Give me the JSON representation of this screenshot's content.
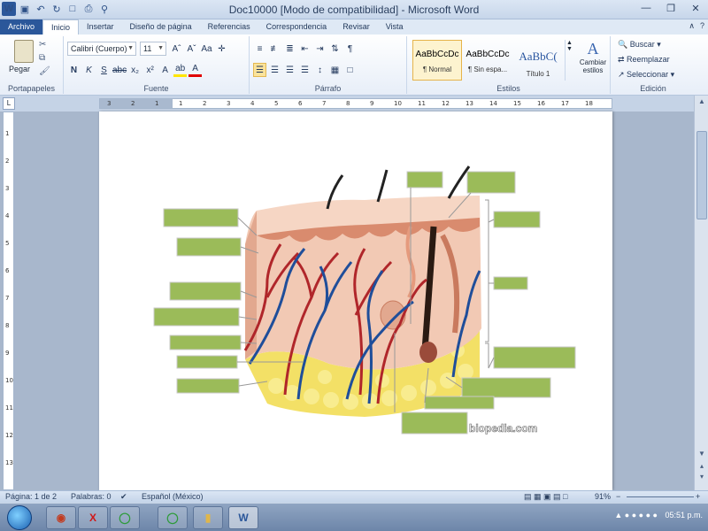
{
  "window": {
    "title": "Doc10000 [Modo de compatibilidad]  -  Microsoft Word"
  },
  "tabs": [
    "Archivo",
    "Inicio",
    "Insertar",
    "Diseño de página",
    "Referencias",
    "Correspondencia",
    "Revisar",
    "Vista"
  ],
  "ribbon": {
    "clipboard": {
      "paste": "Pegar",
      "group": "Portapapeles"
    },
    "font": {
      "name": "Calibri (Cuerpo)",
      "size": "11",
      "group": "Fuente"
    },
    "paragraph": {
      "group": "Párrafo"
    },
    "styles": {
      "group": "Estilos",
      "items": [
        {
          "sample": "AaBbCcDc",
          "name": "¶ Normal"
        },
        {
          "sample": "AaBbCcDc",
          "name": "¶ Sin espa..."
        },
        {
          "sample": "AaBbC(",
          "name": "Título 1"
        }
      ],
      "change": "Cambiar estilos"
    },
    "editing": {
      "group": "Edición",
      "find": "Buscar",
      "replace": "Reemplazar",
      "select": "Seleccionar"
    }
  },
  "ruler": {
    "h_ticks": [
      "3",
      "2",
      "1",
      "1",
      "2",
      "3",
      "4",
      "5",
      "6",
      "7",
      "8",
      "9",
      "10",
      "11",
      "12",
      "13",
      "14",
      "15",
      "16",
      "17",
      "18"
    ],
    "v_ticks": [
      "1",
      "2",
      "3",
      "4",
      "5",
      "6",
      "7",
      "8",
      "9",
      "10",
      "11",
      "12",
      "13"
    ]
  },
  "document": {
    "watermark": "biopedia.com"
  },
  "statusbar": {
    "page": "Página: 1 de 2",
    "words": "Palabras: 0",
    "language": "Español (México)",
    "zoom": "91%"
  },
  "taskbar": {
    "clock": "05:51 p.m."
  },
  "colors": {
    "label_box": "#9bbb59",
    "artery": "#b0262a",
    "vein": "#1f4e9a",
    "fat": "#f3e066"
  }
}
